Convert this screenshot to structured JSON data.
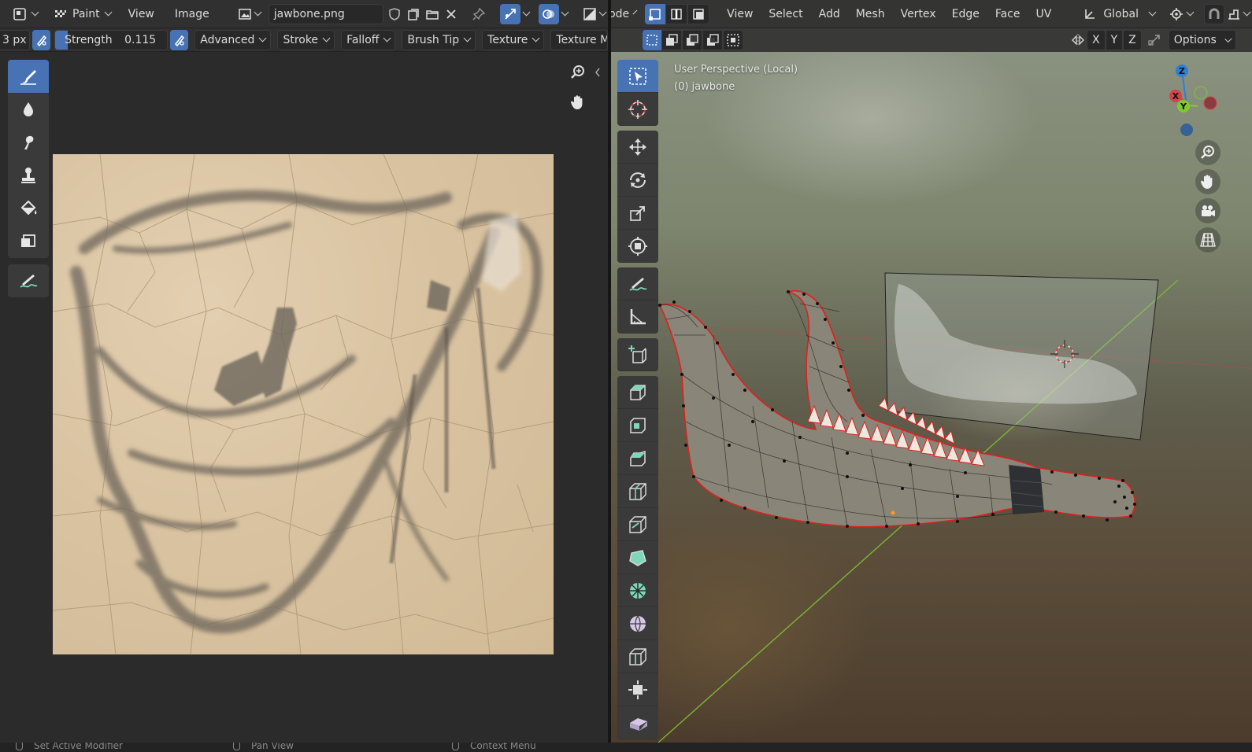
{
  "image_editor": {
    "header": {
      "mode": "Paint",
      "menus": [
        "View",
        "Image"
      ],
      "image_name": "jawbone.png"
    },
    "tool_settings": {
      "radius_value": "3 px",
      "strength_label": "Strength",
      "strength_value": "0.115",
      "panels": [
        "Advanced",
        "Stroke",
        "Falloff",
        "Brush Tip",
        "Texture",
        "Texture Mask"
      ]
    },
    "tools": [
      "draw-brush",
      "soften-brush",
      "smear-brush",
      "clone-brush",
      "fill-brush",
      "mask-brush",
      "annotate"
    ]
  },
  "viewport": {
    "header": {
      "mode": "Edit Mode",
      "menus": [
        "View",
        "Select",
        "Add",
        "Mesh",
        "Vertex",
        "Edge",
        "Face",
        "UV"
      ],
      "transform_orientation": "Global"
    },
    "tool_header": {
      "axes": [
        "X",
        "Y",
        "Z"
      ],
      "options_label": "Options"
    },
    "info": {
      "perspective": "User Perspective (Local)",
      "object": "(0) jawbone"
    },
    "gizmo": {
      "x_label": "X",
      "y_label": "Y",
      "z_label": "Z",
      "x_color": "#d9414a",
      "y_color": "#7fc92f",
      "z_color": "#2e7fd8"
    },
    "tools": [
      "select-box",
      "cursor",
      "move",
      "rotate",
      "scale",
      "transform",
      "annotate",
      "measure",
      "add-cube",
      "extrude",
      "inset",
      "bevel",
      "loop-cut",
      "knife",
      "poly-build",
      "spin",
      "smooth",
      "edge-slide",
      "shrink-fatten",
      "shear"
    ]
  },
  "status_bar": {
    "left": "Set Active Modifier",
    "middle": "Pan View",
    "right": "Context Menu"
  },
  "colors": {
    "accent": "#4772b3",
    "selected_edge": "#e0201c",
    "background": "#2b2b2b"
  }
}
